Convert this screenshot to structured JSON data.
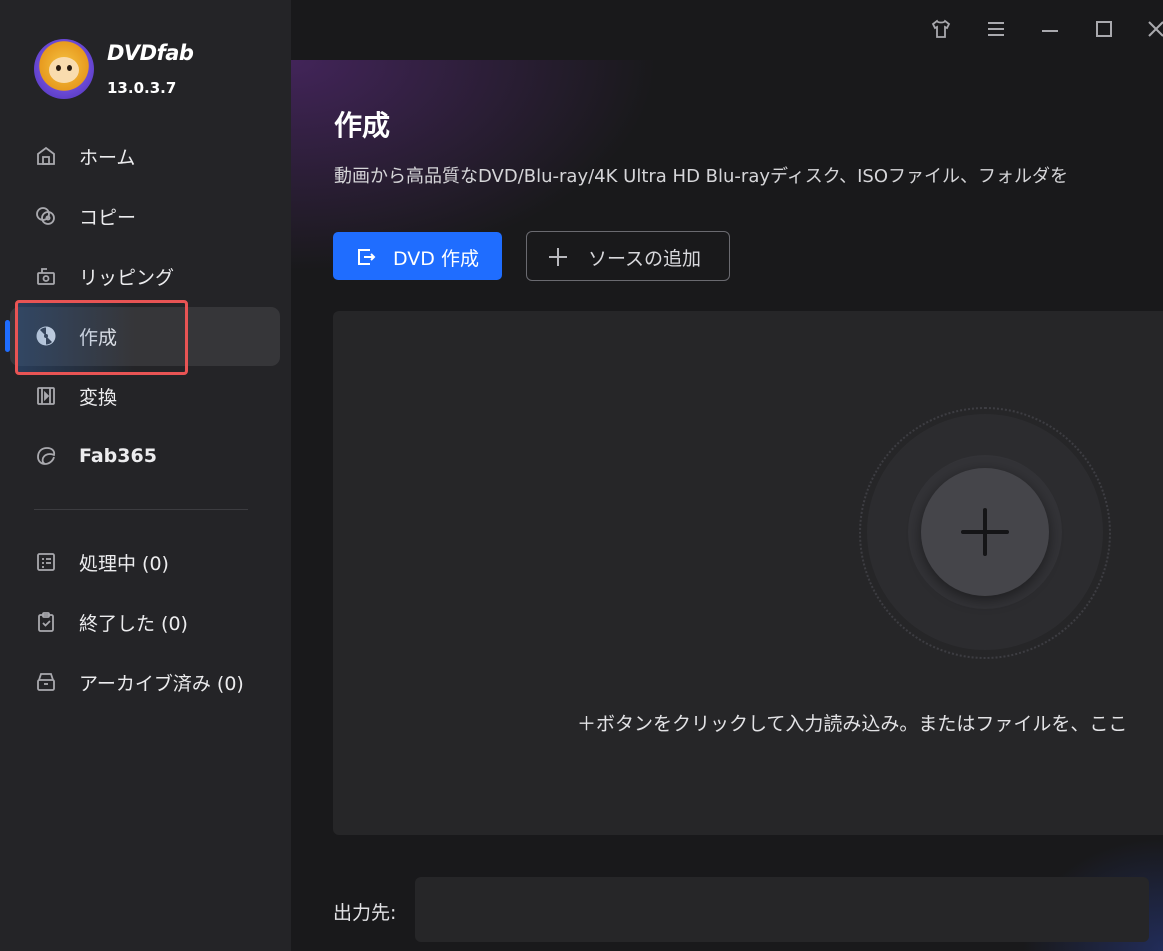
{
  "app": {
    "brand": "DVDfab",
    "version": "13.0.3.7"
  },
  "nav": {
    "items": [
      {
        "label": "ホーム",
        "icon": "home-icon"
      },
      {
        "label": "コピー",
        "icon": "copy-disc-icon"
      },
      {
        "label": "リッピング",
        "icon": "ripper-icon"
      },
      {
        "label": "作成",
        "icon": "creator-disc-icon",
        "active": true
      },
      {
        "label": "変換",
        "icon": "film-icon"
      },
      {
        "label": "Fab365",
        "icon": "fab365-icon"
      }
    ],
    "tasks": [
      {
        "label": "処理中 (0)",
        "icon": "task-list-icon"
      },
      {
        "label": "終了した (0)",
        "icon": "clipboard-check-icon"
      },
      {
        "label": "アーカイブ済み (0)",
        "icon": "archive-icon"
      }
    ]
  },
  "titlebar": {
    "icons": [
      "skin-icon",
      "menu-icon",
      "minimize-icon",
      "maximize-icon",
      "close-icon"
    ]
  },
  "main": {
    "title": "作成",
    "description": "動画から高品質なDVD/Blu-ray/4K Ultra HD Blu-rayディスク、ISOファイル、フォルダを",
    "primary_button": "DVD 作成",
    "add_source_button": "ソースの追加",
    "drop_hint": "＋ボタンをクリックして入力読み込み。またはファイルを、ここ",
    "output_label": "出力先:",
    "output_value": ""
  },
  "colors": {
    "accent": "#1f6dff",
    "highlight": "#e85454",
    "sidebar": "#242427",
    "background": "#19191b"
  }
}
